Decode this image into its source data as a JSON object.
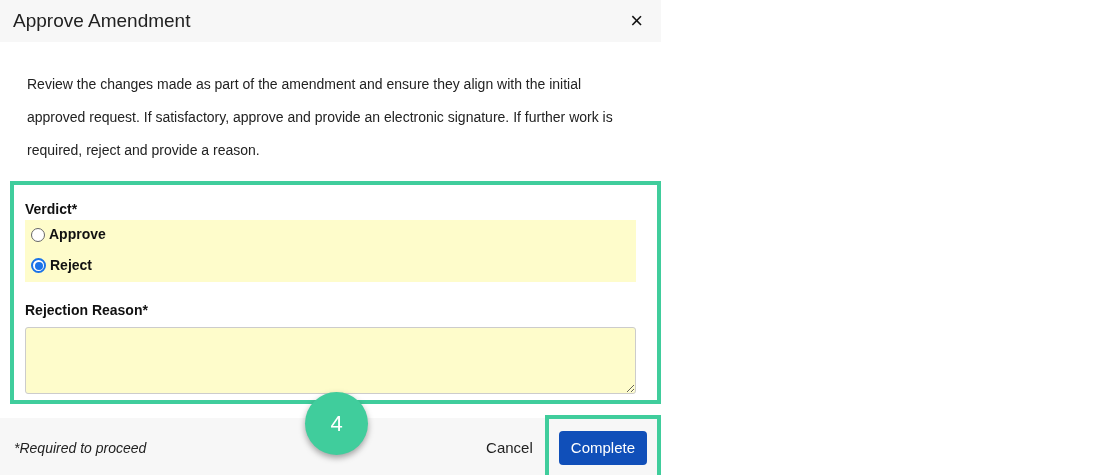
{
  "dialog": {
    "title": "Approve Amendment",
    "close": "×"
  },
  "description": "Review the changes made as part of the amendment and ensure they align with the initial approved request. If satisfactory, approve and provide an electronic signature. If further work is required, reject and provide a reason.",
  "verdict": {
    "label": "Verdict*",
    "options": [
      {
        "label": "Approve",
        "selected": false
      },
      {
        "label": "Reject",
        "selected": true
      }
    ]
  },
  "rejection_reason": {
    "label": "Rejection Reason*"
  },
  "footer": {
    "note": "*Required to proceed",
    "buttons": [
      "Cancel",
      "Complete"
    ]
  },
  "step_badge": "4"
}
